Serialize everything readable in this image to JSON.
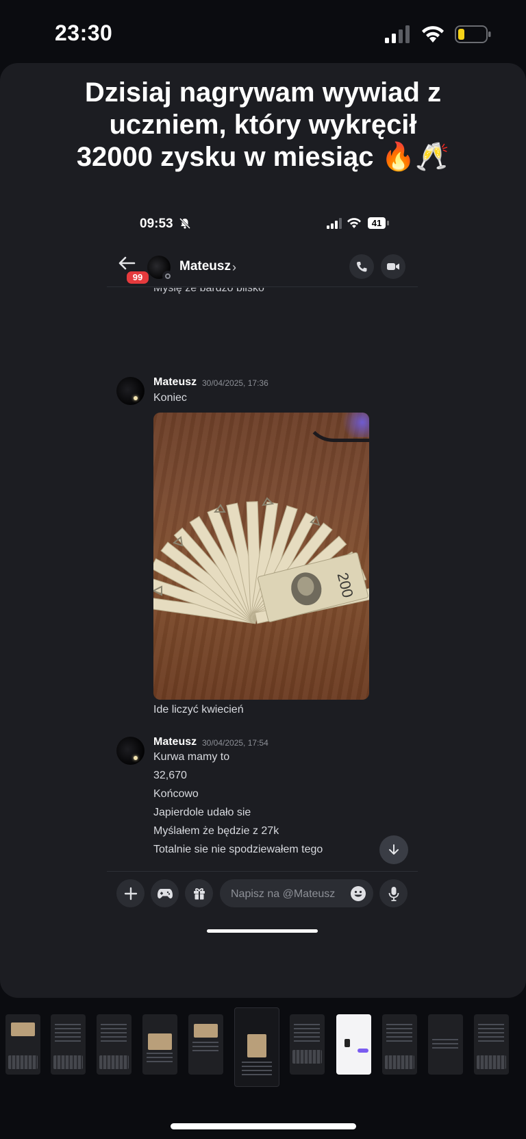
{
  "os_status": {
    "time": "23:30"
  },
  "caption": "Dzisiaj nagrywam wywiad z uczniem, który wykręcił 32000 zysku w miesiąc 🔥🥂",
  "inner_status": {
    "time": "09:53",
    "battery": "41"
  },
  "chat_header": {
    "unread_badge": "99",
    "contact_name": "Mateusz",
    "chevron": "›"
  },
  "cut_message": "Myslę że bardzo blisko",
  "messages": [
    {
      "author": "Mateusz",
      "timestamp": "30/04/2025, 17:36",
      "lines": [
        "Koniec"
      ],
      "after_image": "Ide liczyć kwiecień"
    },
    {
      "author": "Mateusz",
      "timestamp": "30/04/2025, 17:54",
      "lines": [
        "Kurwa mamy to",
        "32,670",
        "Końcowo",
        "Japierdole udało sie",
        "Myślałem że będzie z 27k",
        "Totalnie sie nie spodziewałem tego"
      ]
    }
  ],
  "composer": {
    "placeholder": "Napisz na @Mateusz"
  },
  "icons": {
    "back": "arrow-left-icon",
    "call": "phone-icon",
    "video": "video-camera-icon",
    "plus": "plus-icon",
    "game": "gamepad-icon",
    "gift": "gift-icon",
    "emoji": "smiley-icon",
    "mic": "microphone-icon",
    "scroll": "arrow-down-icon"
  },
  "colors": {
    "badge": "#e53a3d",
    "card_bg": "#1c1d22",
    "page_bg": "#0b0c10"
  }
}
